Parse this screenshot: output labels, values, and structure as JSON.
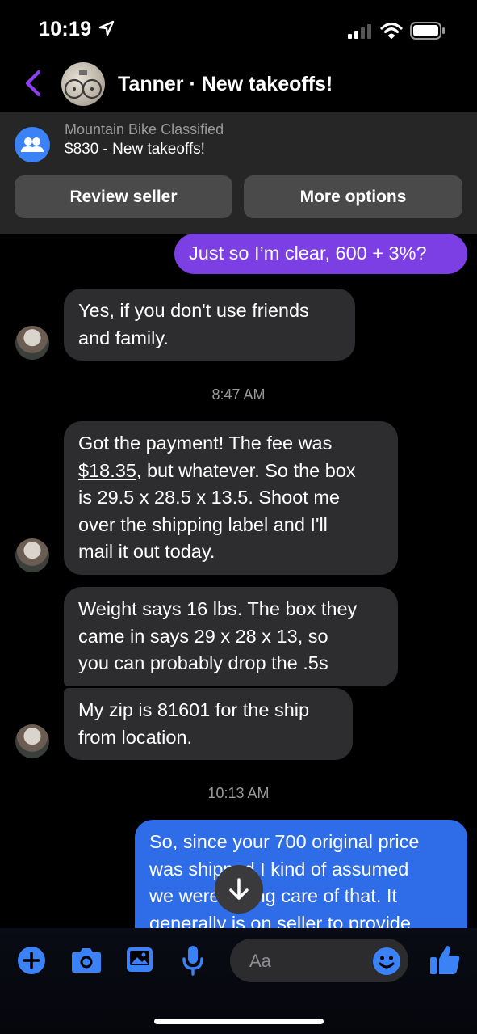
{
  "status_bar": {
    "time": "10:19"
  },
  "header": {
    "title": "Tanner · New takeoffs!"
  },
  "listing": {
    "group": "Mountain Bike Classified",
    "title": "$830 - New takeoffs!",
    "review_label": "Review seller",
    "more_label": "More options"
  },
  "messages": {
    "m1": "Just so I’m clear, 600 + 3%?",
    "m2_l1": "Yes, if you don't use friends",
    "m2_l2": "and family.",
    "t1": "8:47 AM",
    "m3_l1": "Got the payment! The fee was",
    "m3_price": "$18.35",
    "m3_l2_rest": ", but whatever. So the box",
    "m3_l3": "is 29.5 x 28.5 x 13.5. Shoot me",
    "m3_l4": "over the shipping label and I'll",
    "m3_l5": "mail it out today.",
    "m4_l1": "Weight says 16 lbs. The box they",
    "m4_l2": "came in says 29 x 28 x 13, so",
    "m4_l3": "you can probably drop the .5s",
    "m5_l1": "My zip is 81601 for the ship",
    "m5_l2": "from location.",
    "t2": "10:13 AM",
    "m6_l1": "So, since your 700 original price",
    "m6_l2": "was shipped I kind of assumed",
    "m6_l3": "we were taking care of that. It",
    "m6_l4": "generally is on seller to provide"
  },
  "composer": {
    "placeholder": "Aa"
  },
  "colors": {
    "accent_purple": "#7b3fe4",
    "accent_blue": "#3b82f6",
    "incoming_bubble": "#2d2d2f"
  }
}
